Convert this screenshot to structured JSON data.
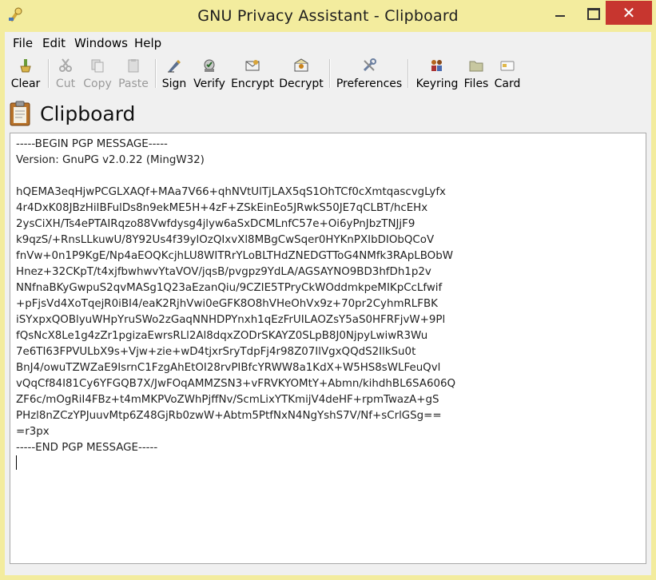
{
  "window": {
    "title": "GNU Privacy Assistant - Clipboard",
    "close_glyph": "✕"
  },
  "menu": {
    "file": "File",
    "edit": "Edit",
    "windows": "Windows",
    "help": "Help"
  },
  "toolbar": {
    "clear": "Clear",
    "cut": "Cut",
    "copy": "Copy",
    "paste": "Paste",
    "sign": "Sign",
    "verify": "Verify",
    "encrypt": "Encrypt",
    "decrypt": "Decrypt",
    "preferences": "Preferences",
    "keyring": "Keyring",
    "files": "Files",
    "card": "Card"
  },
  "heading": {
    "text": "Clipboard"
  },
  "clipboard": {
    "content": "-----BEGIN PGP MESSAGE-----\nVersion: GnuPG v2.0.22 (MingW32)\n\nhQEMA3eqHjwPCGLXAQf+MAa7V66+qhNVtUlTjLAX5qS1OhTCf0cXmtqascvgLyfx\n4r4DxK08JBzHiIBFulDs8n9ekME5H+4zF+ZSkEinEo5JRwkS50JE7qCLBT/hcEHx\n2ysCiXH/Ts4ePTAIRqzo88Vwfdysg4jlyw6aSxDCMLnfC57e+Oi6yPnJbzTNJjF9\nk9qzS/+RnsLLkuwU/8Y92Us4f39ylOzQIxvXl8MBgCwSqer0HYKnPXIbDIObQCoV\nfnVw+0n1P9KgE/Np4aEOQKcjhLU8WITRrYLoBLTHdZNEDGTToG4NMfk3RApLBObW\nHnez+32CKpT/t4xjfbwhwvYtaVOV/jqsB/pvgpz9YdLA/AGSAYNO9BD3hfDh1p2v\nNNfnaBKyGwpuS2qvMASg1Q23aEzanQiu/9CZIE5TPryCkWOddmkpeMIKpCcLfwif\n+pFjsVd4XoTqejR0iBI4/eaK2RjhVwi0eGFK8O8hVHeOhVx9z+70pr2CyhmRLFBK\niSYxpxQOBlyuWHpYruSWo2zGaqNNHDPYnxh1qEzFrUILAOZsY5aS0HFRFjvW+9Pl\nfQsNcX8Le1g4zZr1pgizaEwrsRLl2Al8dqxZODrSKAYZ0SLpB8J0NjpyLwiwR3Wu\n7e6TI63FPVULbX9s+Vjw+zie+wD4tjxrSryTdpFj4r98Z07IlVgxQQdS2IlkSu0t\nBnJ4/owuTZWZaE9IsrnC1FzgAhEtOI28rvPIBfcYRWW8a1KdX+W5HS8sWLFeuQvl\nvQqCf84I81Cy6YFGQB7X/JwFOqAMMZSN3+vFRVKYOMtY+Abmn/kihdhBL6SA606Q\nZF6c/mOgRiI4FBz+t4mMKPVoZWhPjffNv/ScmLixYTKmijV4deHF+rpmTwazA+gS\nPHzl8nZCzYPJuuvMtp6Z48GjRb0zwW+Abtm5PtfNxN4NgYshS7V/Nf+sCrlGSg==\n=r3px\n-----END PGP MESSAGE-----"
  },
  "icons": {
    "app": "app-key-icon",
    "clear": "clear-broom-icon",
    "cut": "scissors-icon",
    "copy": "copy-icon",
    "paste": "paste-icon",
    "sign": "sign-pen-icon",
    "verify": "verify-seal-icon",
    "encrypt": "encrypt-envelope-icon",
    "decrypt": "decrypt-envelope-icon",
    "preferences": "preferences-tools-icon",
    "keyring": "keyring-people-icon",
    "files": "folder-icon",
    "card": "smartcard-icon",
    "heading": "clipboard-icon"
  },
  "colors": {
    "titlebar": "#f3ec9e",
    "close_button": "#c7362f",
    "disabled_text": "#9a9a9a"
  }
}
